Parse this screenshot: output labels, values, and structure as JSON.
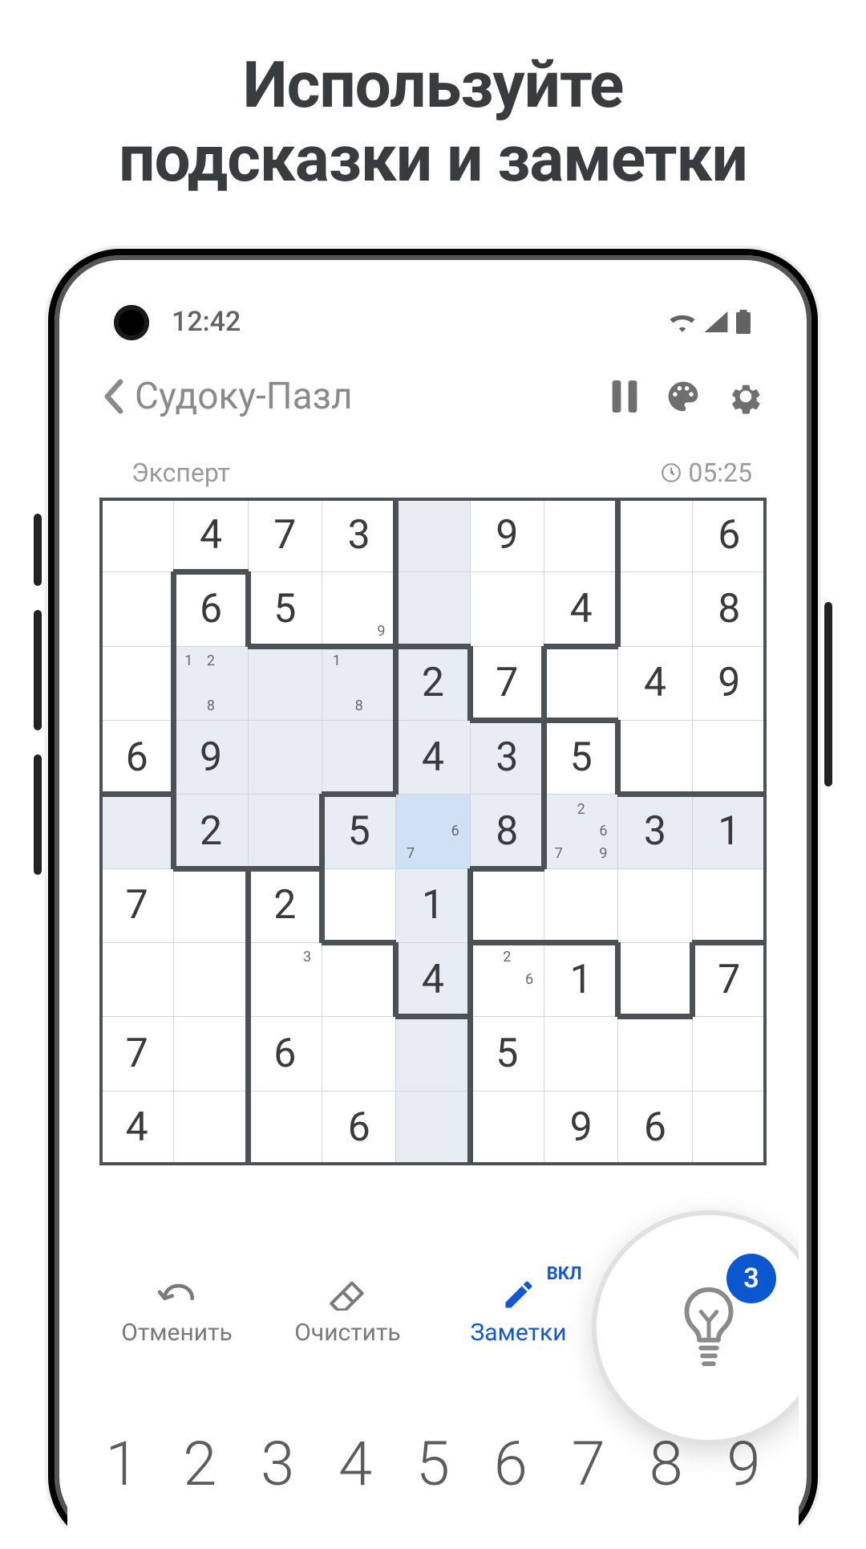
{
  "promo": {
    "headline_l1": "Используйте",
    "headline_l2": "подсказки и заметки"
  },
  "statusbar": {
    "time": "12:42"
  },
  "header": {
    "title": "Судоку-Пазл"
  },
  "subheader": {
    "difficulty": "Эксперт",
    "elapsed": "05:25"
  },
  "actions": {
    "undo": "Отменить",
    "erase": "Очистить",
    "notes": "Заметки",
    "notes_state": "ВКЛ",
    "hint_count": "3"
  },
  "numpad": [
    "1",
    "2",
    "3",
    "4",
    "5",
    "6",
    "7",
    "8",
    "9"
  ],
  "board": {
    "highlight_col": 4,
    "selected": {
      "r": 4,
      "c": 4
    },
    "cells": [
      [
        {
          "v": ""
        },
        {
          "v": "4"
        },
        {
          "v": "7"
        },
        {
          "v": "3"
        },
        {
          "v": "",
          "hl": true
        },
        {
          "v": "9"
        },
        {
          "v": ""
        },
        {
          "v": ""
        },
        {
          "v": "6"
        }
      ],
      [
        {
          "v": ""
        },
        {
          "v": "6"
        },
        {
          "v": "5"
        },
        {
          "v": "",
          "n": [
            9
          ]
        },
        {
          "v": "",
          "hl": true
        },
        {
          "v": ""
        },
        {
          "v": "4"
        },
        {
          "v": ""
        },
        {
          "v": "8"
        }
      ],
      [
        {
          "v": ""
        },
        {
          "v": "",
          "n": [
            1,
            2,
            8
          ],
          "hl": true
        },
        {
          "v": "",
          "hl": true
        },
        {
          "v": "",
          "n": [
            1,
            8
          ],
          "hl": true
        },
        {
          "v": "2",
          "hl": true
        },
        {
          "v": "7"
        },
        {
          "v": ""
        },
        {
          "v": "4"
        },
        {
          "v": "9"
        }
      ],
      [
        {
          "v": "6"
        },
        {
          "v": "9",
          "hl": true
        },
        {
          "v": "",
          "hl": true
        },
        {
          "v": "",
          "hl": true
        },
        {
          "v": "4",
          "hl": true
        },
        {
          "v": "3",
          "hl": true
        },
        {
          "v": "5"
        },
        {
          "v": ""
        },
        {
          "v": ""
        }
      ],
      [
        {
          "v": "",
          "hl": true
        },
        {
          "v": "2",
          "hl": true
        },
        {
          "v": "",
          "hl": true
        },
        {
          "v": "5",
          "hl": true
        },
        {
          "v": "",
          "n": [
            6,
            7
          ],
          "hl": true,
          "sel": true
        },
        {
          "v": "8",
          "hl": true
        },
        {
          "v": "",
          "n": [
            2,
            6,
            7,
            9
          ],
          "hl": true
        },
        {
          "v": "3",
          "hl": true
        },
        {
          "v": "1",
          "hl": true
        }
      ],
      [
        {
          "v": "7"
        },
        {
          "v": ""
        },
        {
          "v": "2"
        },
        {
          "v": ""
        },
        {
          "v": "1",
          "hl": true
        },
        {
          "v": ""
        },
        {
          "v": ""
        },
        {
          "v": ""
        },
        {
          "v": ""
        }
      ],
      [
        {
          "v": ""
        },
        {
          "v": ""
        },
        {
          "v": "",
          "n": [
            3
          ]
        },
        {
          "v": ""
        },
        {
          "v": "4",
          "hl": true
        },
        {
          "v": "",
          "n": [
            2,
            6
          ]
        },
        {
          "v": "1"
        },
        {
          "v": ""
        },
        {
          "v": "7"
        }
      ],
      [
        {
          "v": "7"
        },
        {
          "v": ""
        },
        {
          "v": "6"
        },
        {
          "v": ""
        },
        {
          "v": "",
          "hl": true
        },
        {
          "v": "5"
        },
        {
          "v": ""
        },
        {
          "v": ""
        },
        {
          "v": ""
        }
      ],
      [
        {
          "v": "4"
        },
        {
          "v": ""
        },
        {
          "v": ""
        },
        {
          "v": "6"
        },
        {
          "v": "",
          "hl": true
        },
        {
          "v": ""
        },
        {
          "v": "9"
        },
        {
          "v": "6"
        },
        {
          "v": ""
        }
      ]
    ],
    "regions": [
      [
        0,
        0,
        0,
        0,
        1,
        1,
        1,
        2,
        2
      ],
      [
        0,
        3,
        0,
        0,
        1,
        1,
        1,
        2,
        2
      ],
      [
        0,
        3,
        3,
        3,
        4,
        1,
        2,
        2,
        2
      ],
      [
        0,
        3,
        3,
        3,
        4,
        4,
        5,
        2,
        2
      ],
      [
        6,
        3,
        3,
        4,
        4,
        4,
        5,
        5,
        5
      ],
      [
        6,
        6,
        7,
        4,
        4,
        5,
        5,
        5,
        5
      ],
      [
        6,
        6,
        7,
        7,
        4,
        8,
        8,
        5,
        8
      ],
      [
        6,
        6,
        7,
        7,
        7,
        8,
        8,
        8,
        8
      ],
      [
        6,
        6,
        7,
        7,
        7,
        8,
        8,
        8,
        8
      ]
    ]
  }
}
